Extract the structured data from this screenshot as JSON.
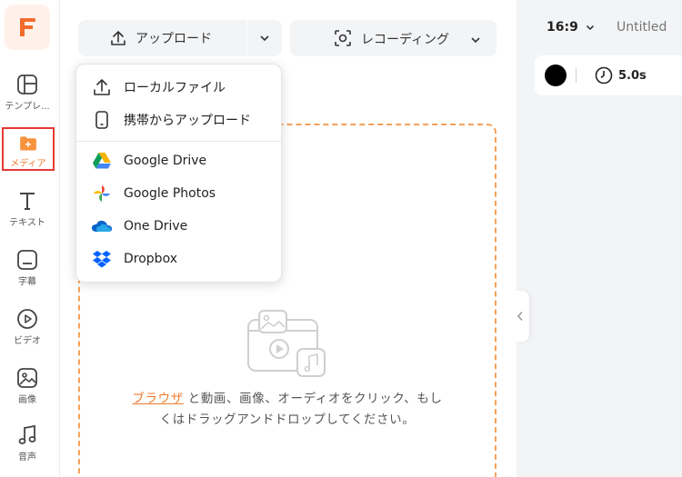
{
  "sidebar": {
    "logo_letter": "F",
    "items": [
      {
        "label": "テンプレ...",
        "icon": "template-icon"
      },
      {
        "label": "メディア",
        "icon": "media-folder-icon",
        "active": true
      },
      {
        "label": "テキスト",
        "icon": "text-icon"
      },
      {
        "label": "字幕",
        "icon": "subtitle-icon"
      },
      {
        "label": "ビデオ",
        "icon": "video-icon"
      },
      {
        "label": "画像",
        "icon": "image-icon"
      },
      {
        "label": "音声",
        "icon": "audio-icon"
      }
    ]
  },
  "toolbar": {
    "upload_label": "アップロード",
    "record_label": "レコーディング"
  },
  "upload_menu": {
    "items": [
      {
        "label": "ローカルファイル",
        "icon": "upload-icon"
      },
      {
        "label": "携帯からアップロード",
        "icon": "phone-icon"
      },
      {
        "label": "Google Drive",
        "icon": "google-drive-icon"
      },
      {
        "label": "Google Photos",
        "icon": "google-photos-icon"
      },
      {
        "label": "One Drive",
        "icon": "onedrive-icon"
      },
      {
        "label": "Dropbox",
        "icon": "dropbox-icon"
      }
    ]
  },
  "dropzone": {
    "link_text": "ブラウザ",
    "text_line1_rest": " と動画、画像、オーディオをクリック、もし",
    "text_line2": "くはドラッグアンドドロップしてください。"
  },
  "right_panel": {
    "aspect_ratio": "16:9",
    "title": "Untitled",
    "duration": "5.0s"
  },
  "colors": {
    "accent": "#f07b2d",
    "active_border": "#e53935",
    "dropzone_border": "#f5a15a"
  }
}
